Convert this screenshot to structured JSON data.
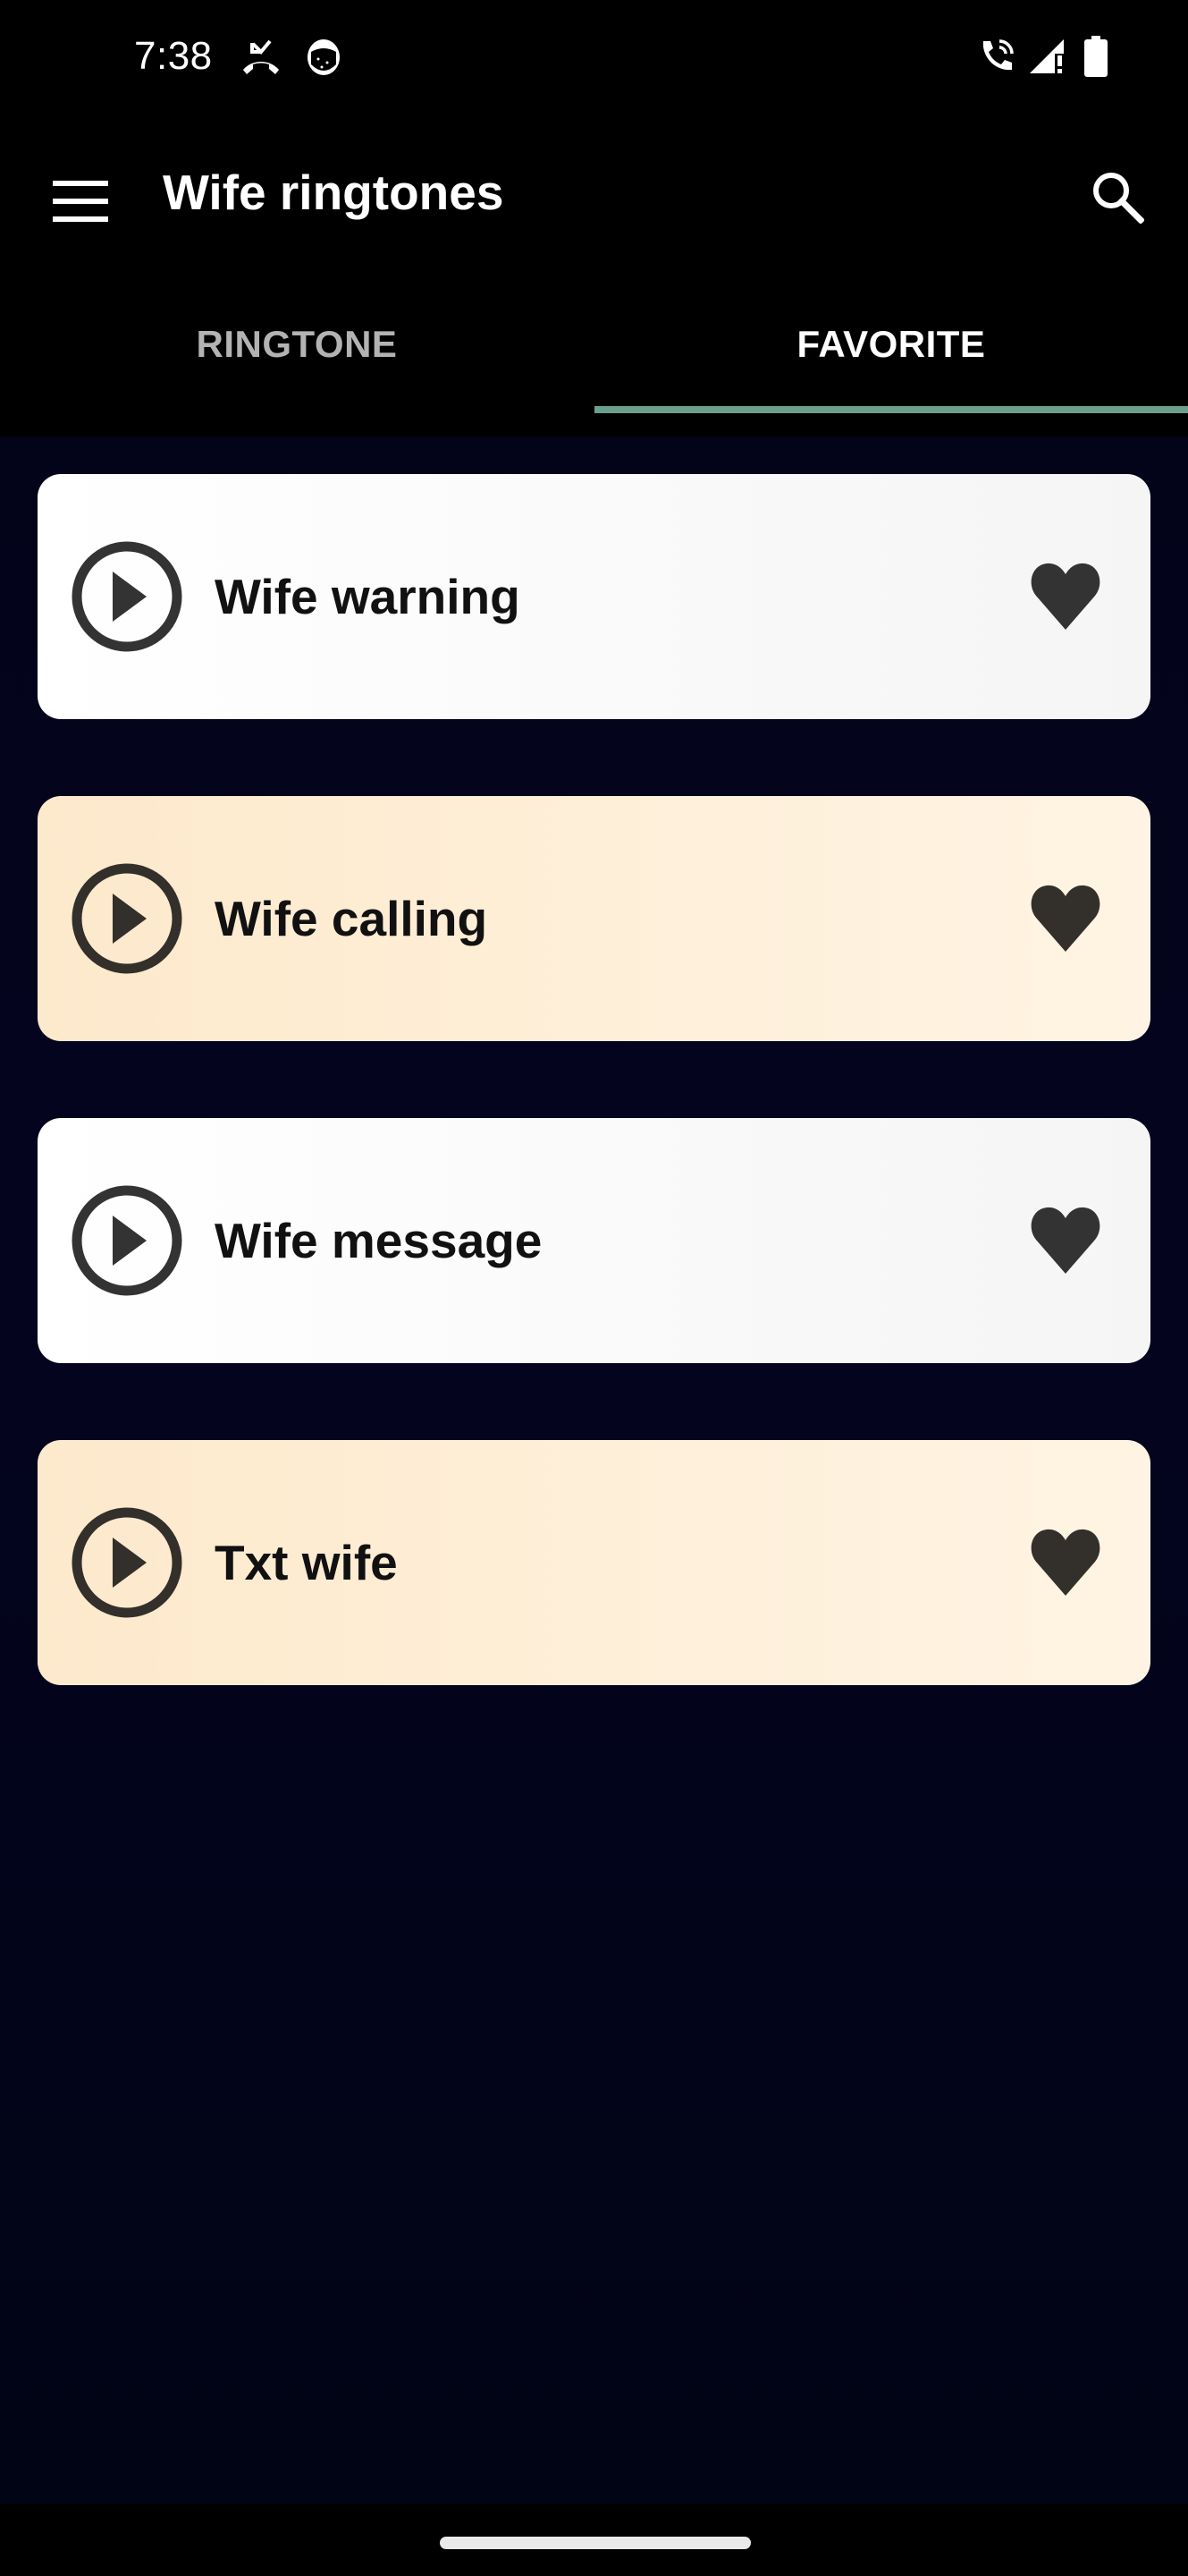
{
  "status_bar": {
    "time": "7:38",
    "left_icons": [
      "missed-call-icon",
      "notification-app-icon"
    ],
    "right_icons": [
      "wifi-calling-icon",
      "signal-no-service-icon",
      "battery-full-icon"
    ]
  },
  "app_bar": {
    "title": "Wife ringtones",
    "menu_icon": "hamburger-menu-icon",
    "search_icon": "search-icon"
  },
  "tabs": [
    {
      "label": "RINGTONE",
      "selected": false
    },
    {
      "label": "FAVORITE",
      "selected": true
    }
  ],
  "colors": {
    "tab_indicator": "#6b9e8b",
    "card_white": "#fafafa",
    "card_cream": "#feefd8",
    "icon_dark": "#333333",
    "background": "#03031a"
  },
  "favorites": [
    {
      "title": "Wife warning",
      "favorited": true,
      "style": "white"
    },
    {
      "title": "Wife calling",
      "favorited": true,
      "style": "cream"
    },
    {
      "title": "Wife message",
      "favorited": true,
      "style": "white"
    },
    {
      "title": "Txt wife",
      "favorited": true,
      "style": "cream"
    }
  ]
}
